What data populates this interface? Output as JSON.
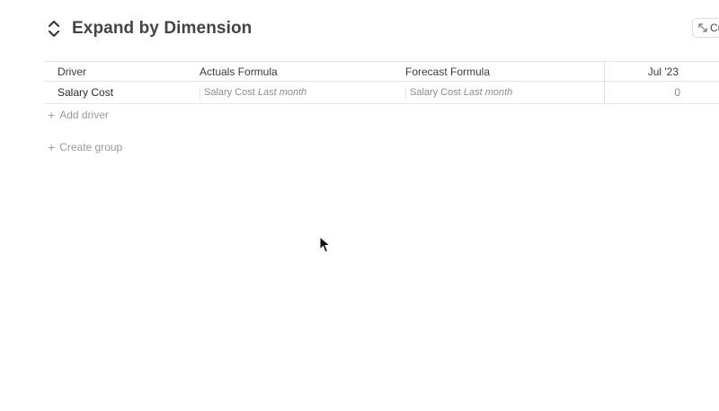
{
  "page": {
    "title": "Expand by Dimension",
    "top_right_button_label": "Cu"
  },
  "table": {
    "columns": [
      "Driver",
      "Actuals Formula",
      "Forecast Formula",
      "Jul '23"
    ],
    "rows": [
      {
        "driver": "Salary Cost",
        "actuals_formula": {
          "ref": "Salary Cost",
          "modifier": "Last month"
        },
        "forecast_formula": {
          "ref": "Salary Cost",
          "modifier": "Last month"
        },
        "jul_23": "0"
      }
    ]
  },
  "actions": {
    "add_driver": "Add driver",
    "create_group": "Create group"
  },
  "icons": {
    "expand": "chevrons-up-down-icon",
    "button": "compress-icon",
    "plus": "plus-icon",
    "cursor": "mouse-pointer-icon"
  }
}
